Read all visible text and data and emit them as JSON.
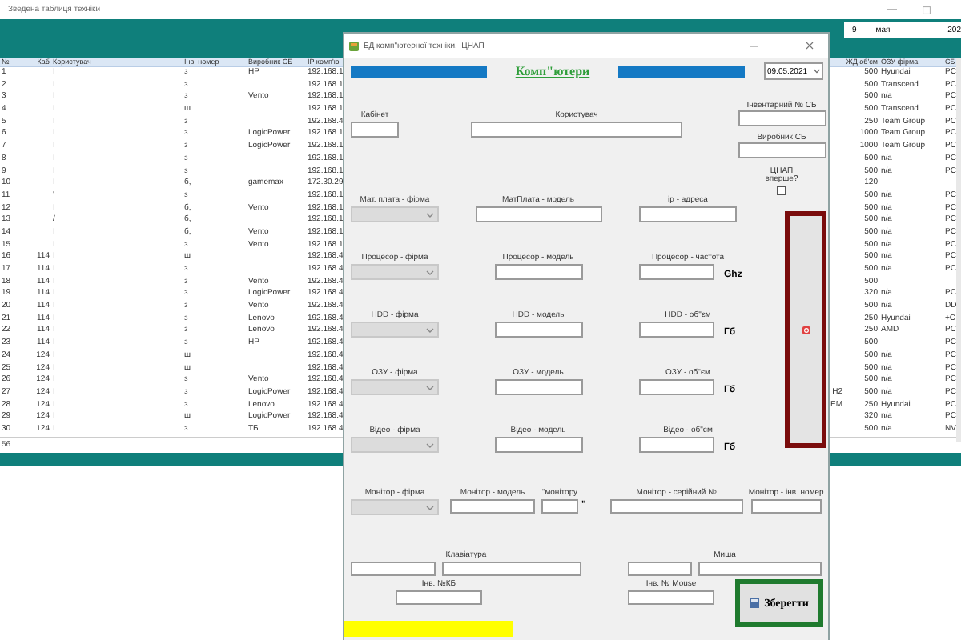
{
  "window": {
    "title": "Зведена таблиця техніки"
  },
  "date_picker": {
    "day": "9",
    "month": "мая",
    "year": "202"
  },
  "table": {
    "columns": [
      "№",
      "Каб",
      "Користувач",
      "Інв. номер",
      "Виробник СБ",
      "IP комп'ю",
      "ЖД об'єм",
      "ОЗУ фірма",
      "СБ"
    ],
    "rows": [
      {
        "no": "1",
        "user": "І",
        "inv": "з",
        "maker": "HP",
        "ip": "192.168.1",
        "hdd": "500",
        "ram": "Hyundai",
        "sb": "PC"
      },
      {
        "no": "2",
        "user": "І",
        "inv": "з",
        "ip": "192.168.1",
        "hdd": "500",
        "ram": "Transcend",
        "sb": "PC"
      },
      {
        "no": "3",
        "user": "І",
        "inv": "з",
        "maker": "Vento",
        "ip": "192.168.1",
        "hdd": "500",
        "ram": "n/a",
        "sb": "PC"
      },
      {
        "no": "4",
        "user": "І",
        "inv": "ш",
        "ip": "192.168.1",
        "hdd": "500",
        "ram": "Transcend",
        "sb": "PC"
      },
      {
        "no": "5",
        "user": "І",
        "inv": "з",
        "ip": "192.168.4",
        "hdd": "250",
        "ram": "Team Group",
        "sb": "PC"
      },
      {
        "no": "6",
        "user": "І",
        "inv": "з",
        "maker": "LogicPower",
        "ip": "192.168.1",
        "hdd": "1000",
        "ram": "Team Group",
        "sb": "PC"
      },
      {
        "no": "7",
        "user": "І",
        "inv": "з",
        "maker": "LogicPower",
        "ip": "192.168.1",
        "hdd": "1000",
        "ram": "Team Group",
        "sb": "PC"
      },
      {
        "no": "8",
        "user": "І",
        "inv": "з",
        "ip": "192.168.1",
        "hdd": "500",
        "ram": "n/a",
        "sb": "PC"
      },
      {
        "no": "9",
        "user": "І",
        "inv": "з",
        "ip": "192.168.1",
        "hdd": "500",
        "ram": "n/a",
        "sb": "PC"
      },
      {
        "no": "10",
        "user": "І",
        "inv": "б,",
        "maker": "gamemax",
        "ip": "172.30.29",
        "hdd": "120"
      },
      {
        "no": "11",
        "user": "'",
        "inv": "з",
        "ip": "192.168.1",
        "hdd": "500",
        "ram": "n/a",
        "sb": "PC"
      },
      {
        "no": "12",
        "user": "І",
        "inv": "б,",
        "maker": "Vento",
        "ip": "192.168.1",
        "hdd": "500",
        "ram": "n/a",
        "sb": "PC"
      },
      {
        "no": "13",
        "user": "/",
        "inv": "б,",
        "ip": "192.168.1",
        "hdd": "500",
        "ram": "n/a",
        "sb": "PC"
      },
      {
        "no": "14",
        "user": "І",
        "inv": "б,",
        "maker": "Vento",
        "ip": "192.168.1",
        "hdd": "500",
        "ram": "n/a",
        "sb": "PC"
      },
      {
        "no": "15",
        "user": "І",
        "inv": "з",
        "maker": "Vento",
        "ip": "192.168.1",
        "hdd": "500",
        "ram": "n/a",
        "sb": "PC"
      },
      {
        "no": "16",
        "cab": "114",
        "user": "І",
        "inv": "ш",
        "ip": "192.168.4",
        "hdd": "500",
        "ram": "n/a",
        "sb": "PC"
      },
      {
        "no": "17",
        "cab": "114",
        "user": "І",
        "inv": "з",
        "ip": "192.168.4",
        "hdd": "500",
        "ram": "n/a",
        "sb": "PC"
      },
      {
        "no": "18",
        "cab": "114",
        "user": "І",
        "inv": "з",
        "maker": "Vento",
        "ip": "192.168.4",
        "hdd": "500"
      },
      {
        "no": "19",
        "cab": "114",
        "user": "І",
        "inv": "з",
        "maker": "LogicPower",
        "ip": "192.168.4",
        "hdd": "320",
        "ram": "n/a",
        "sb": "PC"
      },
      {
        "no": "20",
        "cab": "114",
        "user": "І",
        "inv": "з",
        "maker": "Vento",
        "ip": "192.168.4",
        "hdd": "500",
        "ram": "n/a",
        "sb": "DD"
      },
      {
        "no": "21",
        "cab": "114",
        "user": "І",
        "inv": "з",
        "maker": "Lenovo",
        "ip": "192.168.4",
        "hdd": "250",
        "ram": "Hyundai",
        "sb": "+C"
      },
      {
        "no": "22",
        "cab": "114",
        "user": "І",
        "inv": "з",
        "maker": "Lenovo",
        "ip": "192.168.4",
        "hdd": "250",
        "ram": "AMD",
        "sb": "PC"
      },
      {
        "no": "23",
        "cab": "114",
        "user": "І",
        "inv": "з",
        "maker": "HP",
        "ip": "192.168.4",
        "hdd": "500",
        "sb": "PC"
      },
      {
        "no": "24",
        "cab": "124",
        "user": "І",
        "inv": "ш",
        "ip": "192.168.4",
        "hdd": "500",
        "ram": "n/a",
        "sb": "PC"
      },
      {
        "no": "25",
        "cab": "124",
        "user": "І",
        "inv": "ш",
        "ip": "192.168.4",
        "hdd": "500",
        "ram": "n/a",
        "sb": "PC"
      },
      {
        "no": "26",
        "cab": "124",
        "user": "І",
        "inv": "з",
        "maker": "Vento",
        "ip": "192.168.4",
        "hdd": "500",
        "ram": "n/a",
        "sb": "PC"
      },
      {
        "no": "27",
        "cab": "124",
        "user": "І",
        "inv": "з",
        "maker": "LogicPower",
        "ip": "192.168.4",
        "column_7": "H2",
        "hdd": "500",
        "ram": "n/a",
        "sb": "PC"
      },
      {
        "no": "28",
        "cab": "124",
        "user": "І",
        "inv": "з",
        "maker": "Lenovo",
        "ip": "192.168.4",
        "column_7": "EM",
        "hdd": "250",
        "ram": "Hyundai",
        "sb": "PC"
      },
      {
        "no": "29",
        "cab": "124",
        "user": "І",
        "inv": "ш",
        "maker": "LogicPower",
        "ip": "192.168.4",
        "hdd": "320",
        "ram": "n/a",
        "sb": "PC"
      },
      {
        "no": "30",
        "cab": "124",
        "user": "І",
        "inv": "з",
        "maker": "ТБ",
        "ip": "192.168.4",
        "hdd": "500",
        "ram": "n/a",
        "sb": "NV"
      }
    ],
    "footer": "56"
  },
  "dialog": {
    "title": "БД комп\"ютерної техніки,  ЦНАП",
    "heading": "Комп\"ютери",
    "date": "09.05.2021",
    "top_fields": [
      "Кабінет",
      "Користувач"
    ],
    "side_fields": [
      "Інвентарний № СБ",
      "Виробник СБ"
    ],
    "first_visit": {
      "label": "ЦНАП вперше?",
      "checked": false
    },
    "component_rows": [
      {
        "firm": "Мат. плата - фірма",
        "model": "МатПлата - модель",
        "third": "ip - адреса",
        "disabled": true
      },
      {
        "firm": "Процесор - фірма",
        "model": "Процесор - модель",
        "third": "Процесор - частота",
        "unit": "Ghz",
        "disabled": true
      },
      {
        "firm": "HDD - фірма",
        "model": "HDD - модель",
        "third": "HDD - об\"єм",
        "unit": "Гб",
        "disabled": true
      },
      {
        "firm": "ОЗУ - фірма",
        "model": "ОЗУ - модель",
        "third": "ОЗУ - об\"єм",
        "unit": "Гб",
        "disabled": true
      },
      {
        "firm": "Відео - фірма",
        "model": "Відео - модель",
        "third": "Відео - об\"єм",
        "unit": "Гб",
        "disabled": true
      }
    ],
    "monitor": {
      "firm": "Монітор  - фірма",
      "model": "Монітор - модель",
      "size": "\"монітору",
      "size_unit": "\"",
      "serial": "Монітор - серійний №",
      "inv": "Монітор - інв. номер",
      "disabled": true
    },
    "keyboard": {
      "label": "Клавіатура",
      "inv_label": "Інв. №КБ"
    },
    "mouse": {
      "label": "Миша",
      "inv_label": "Інв. № Mouse"
    },
    "save_button": "Зберегти"
  }
}
